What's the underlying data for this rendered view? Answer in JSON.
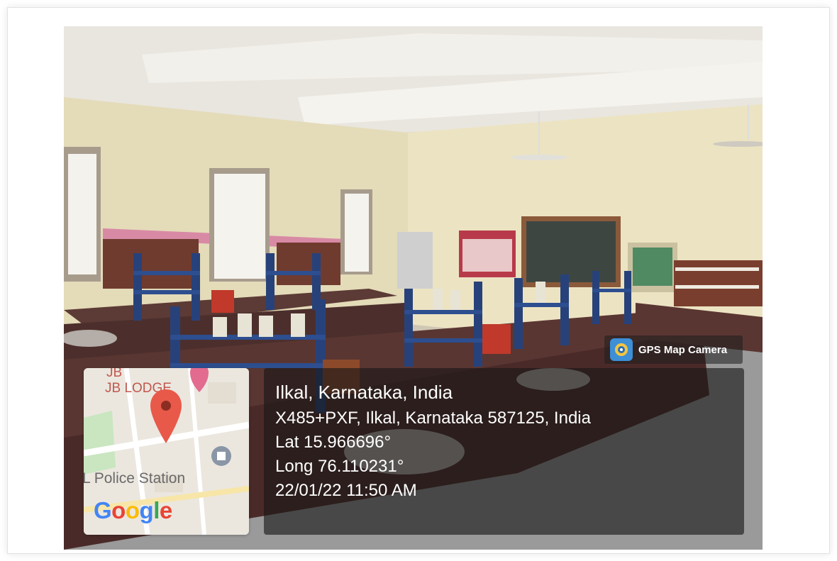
{
  "gps_badge": {
    "label": "GPS Map Camera",
    "icon": "gps-camera-icon",
    "accent": "#3d8fd6"
  },
  "map": {
    "labels": {
      "top_short": "JB",
      "top": "JB LODGE",
      "poi": "L Police Station"
    },
    "brand": "Google",
    "pin_color": "#e8594a"
  },
  "location": {
    "place": "Ilkal, Karnataka, India",
    "address": "X485+PXF, Ilkal, Karnataka 587125, India",
    "latitude": "Lat 15.966696°",
    "longitude": "Long 76.110231°",
    "timestamp": "22/01/22 11:50 AM"
  }
}
